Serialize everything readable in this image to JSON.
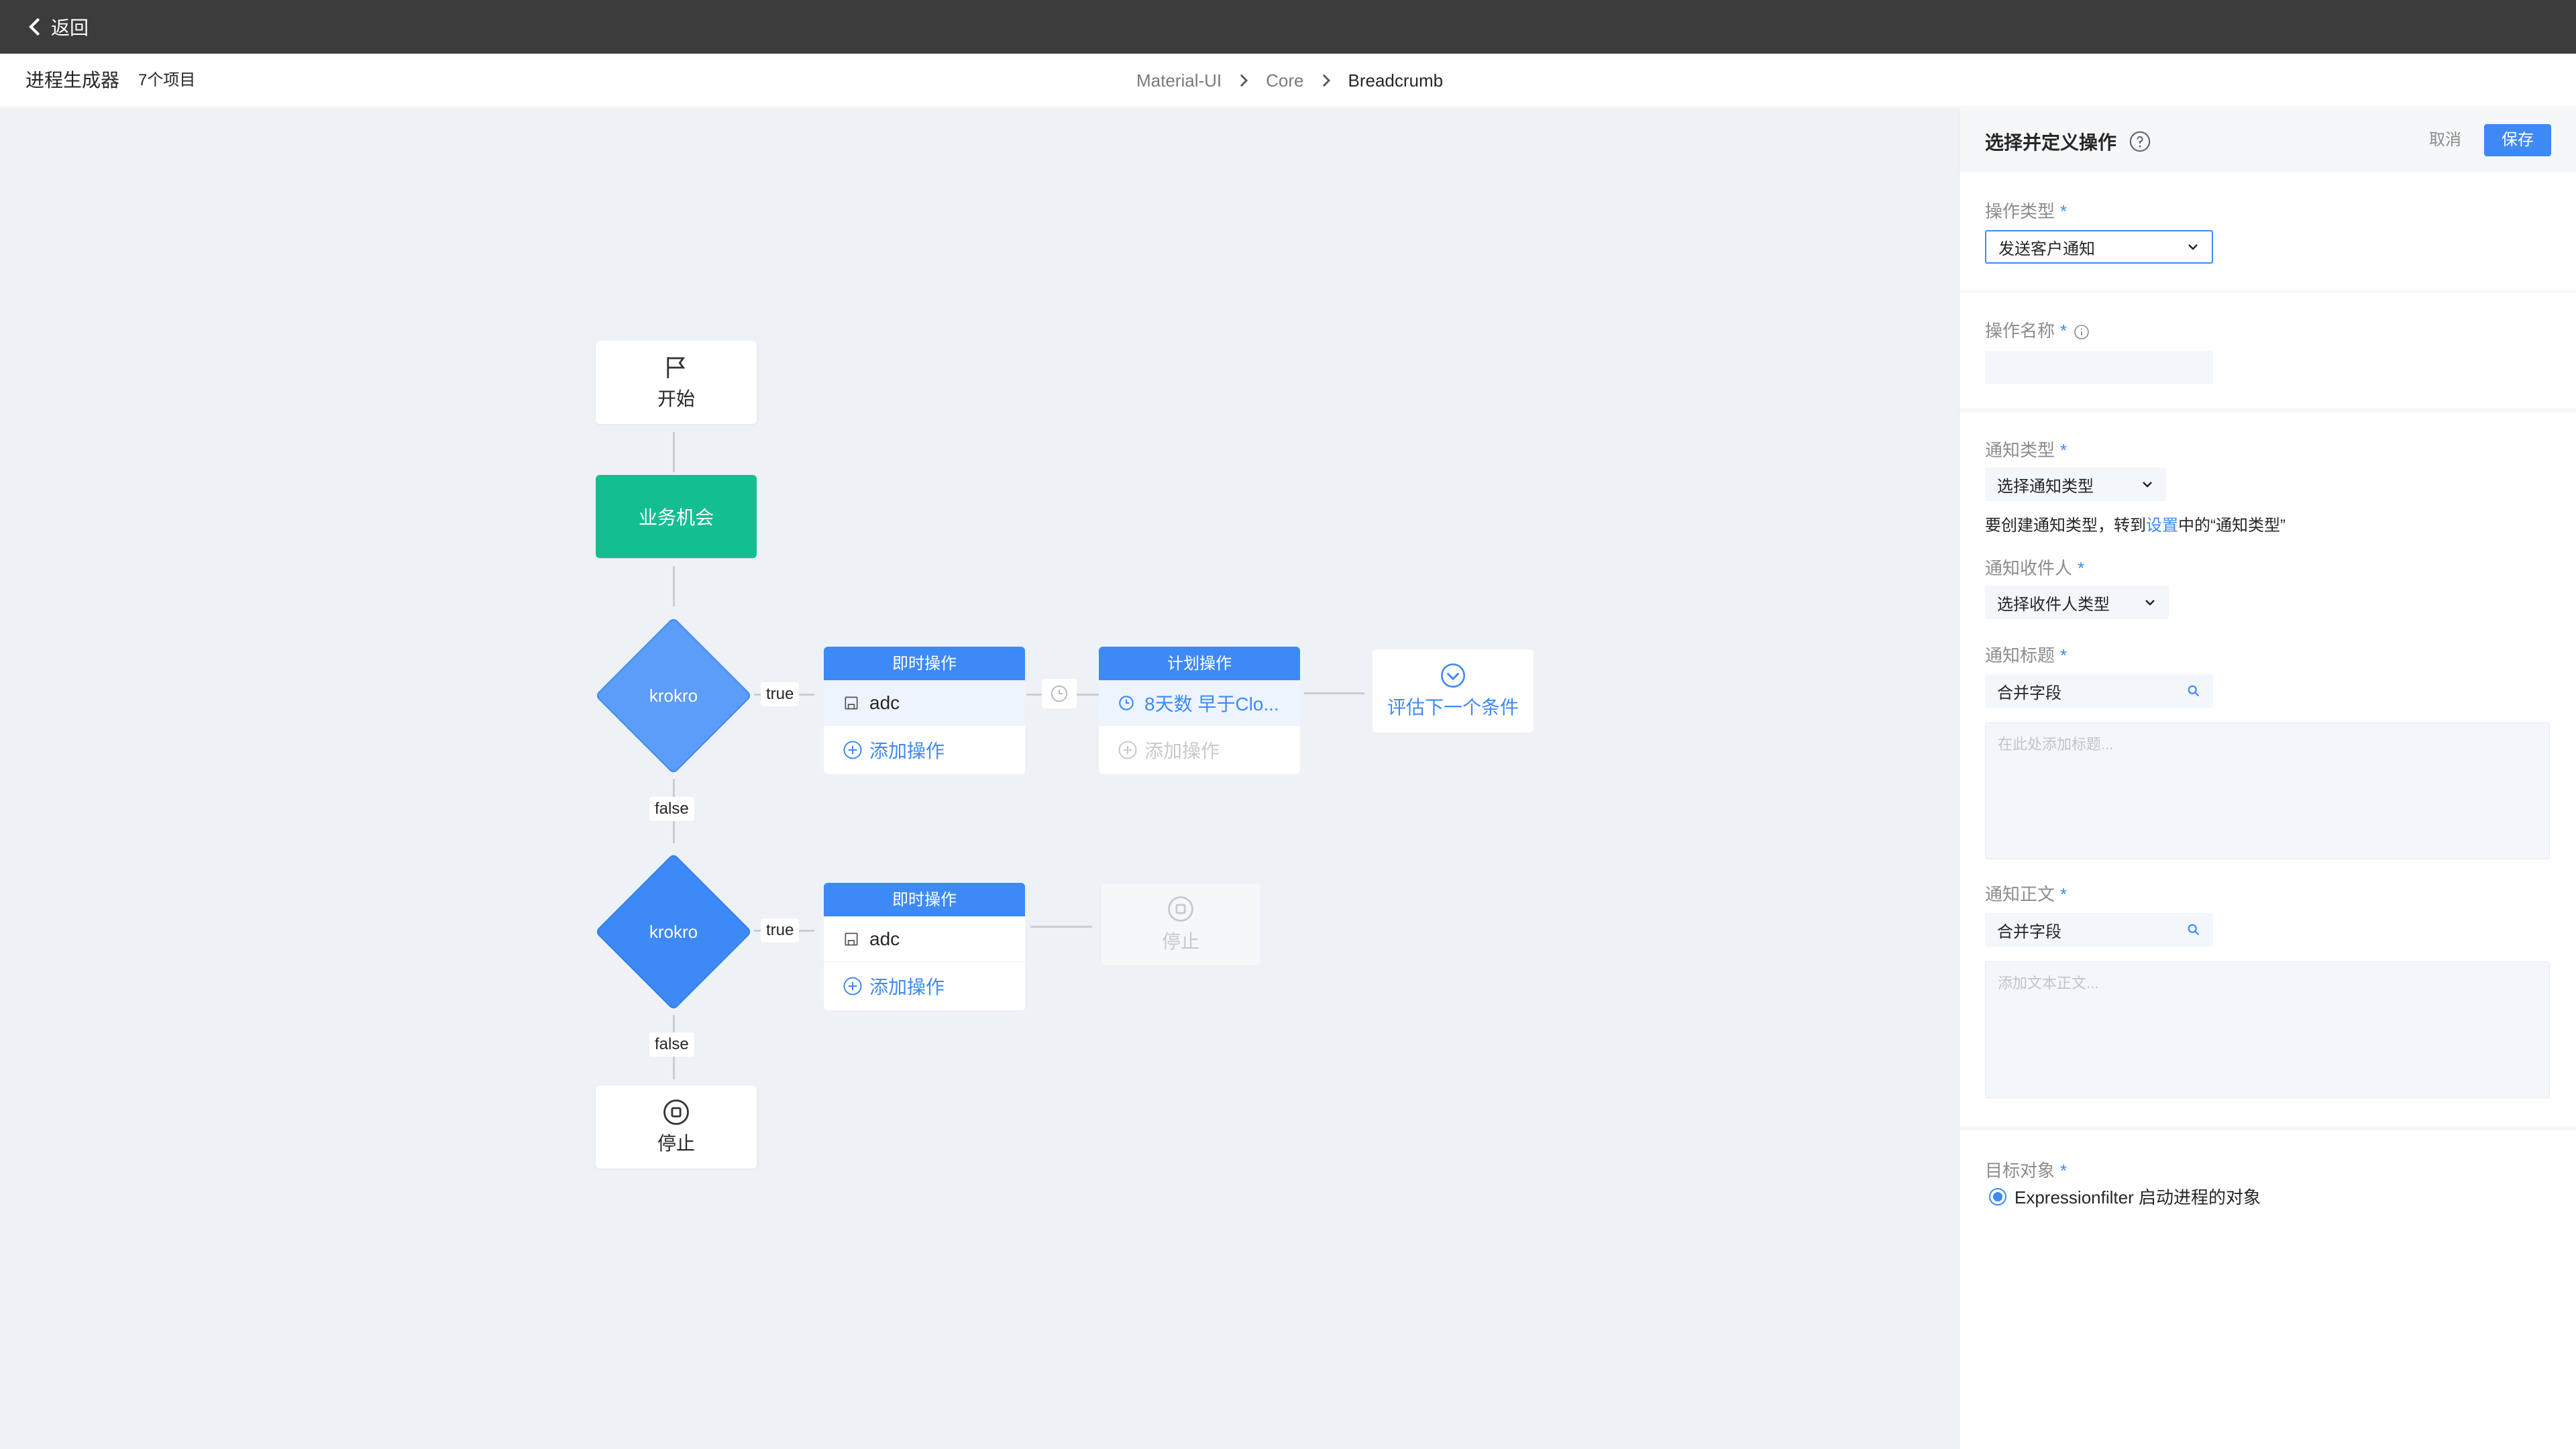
{
  "topbar": {
    "back_label": "返回"
  },
  "header": {
    "title": "进程生成器",
    "count": "7个项目",
    "breadcrumbs": [
      "Material-UI",
      "Core",
      "Breadcrumb"
    ]
  },
  "flow": {
    "start_label": "开始",
    "opportunity_label": "业务机会",
    "condition1_label": "krokro",
    "condition2_label": "krokro",
    "true_label": "true",
    "false_label": "false",
    "immediate_action_title": "即时操作",
    "scheduled_action_title": "计划操作",
    "action_item": "adc",
    "schedule_item": "8天数 早于Clo...",
    "add_action_label": "添加操作",
    "evaluate_next_label": "评估下一个条件",
    "stop_label": "停止"
  },
  "panel": {
    "title": "选择并定义操作",
    "cancel_label": "取消",
    "save_label": "保存",
    "action_type_label": "操作类型",
    "action_type_value": "发送客户通知",
    "action_name_label": "操作名称",
    "action_name_value": "",
    "notification_type_label": "通知类型",
    "notification_type_value": "选择通知类型",
    "hint_prefix": "要创建通知类型，转到",
    "hint_link": "设置",
    "hint_suffix": "中的“通知类型”",
    "recipient_label": "通知收件人",
    "recipient_value": "选择收件人类型",
    "notification_title_label": "通知标题",
    "merge_field_label": "合并字段",
    "title_placeholder": "在此处添加标题...",
    "body_label": "通知正文",
    "body_placeholder": "添加文本正文...",
    "target_label": "目标对象",
    "target_option": "Expressionfilter 启动进程的对象",
    "required_mark": "*"
  },
  "colors": {
    "accent": "#3d8af7",
    "opportunity": "#13bf91",
    "condition1": "#5b9df8",
    "condition2": "#3d8af7",
    "topbar": "#3c3c3c"
  }
}
